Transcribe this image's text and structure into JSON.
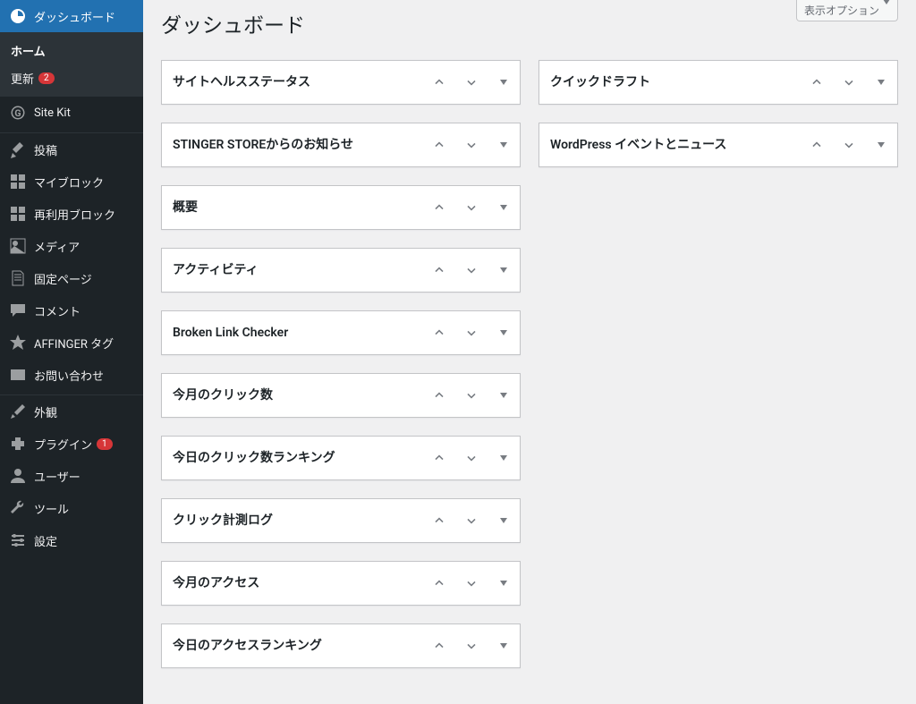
{
  "header": {
    "title": "ダッシュボード",
    "screen_options": "表示オプション"
  },
  "sidebar": {
    "dashboard": "ダッシュボード",
    "home": "ホーム",
    "updates": "更新",
    "updates_badge": "2",
    "sitekit": "Site Kit",
    "posts": "投稿",
    "myblock": "マイブロック",
    "reusable": "再利用ブロック",
    "media": "メディア",
    "pages": "固定ページ",
    "comments": "コメント",
    "affinger": "AFFINGER タグ",
    "contact": "お問い合わせ",
    "appearance": "外観",
    "plugins": "プラグイン",
    "plugins_badge": "1",
    "users": "ユーザー",
    "tools": "ツール",
    "settings": "設定"
  },
  "boxes_left": [
    {
      "title": "サイトヘルスステータス"
    },
    {
      "title": "STINGER STOREからのお知らせ"
    },
    {
      "title": "概要"
    },
    {
      "title": "アクティビティ"
    },
    {
      "title": "Broken Link Checker"
    },
    {
      "title": "今月のクリック数"
    },
    {
      "title": "今日のクリック数ランキング"
    },
    {
      "title": "クリック計測ログ"
    },
    {
      "title": "今月のアクセス"
    },
    {
      "title": "今日のアクセスランキング"
    }
  ],
  "boxes_right": [
    {
      "title": "クイックドラフト"
    },
    {
      "title": "WordPress イベントとニュース"
    }
  ]
}
